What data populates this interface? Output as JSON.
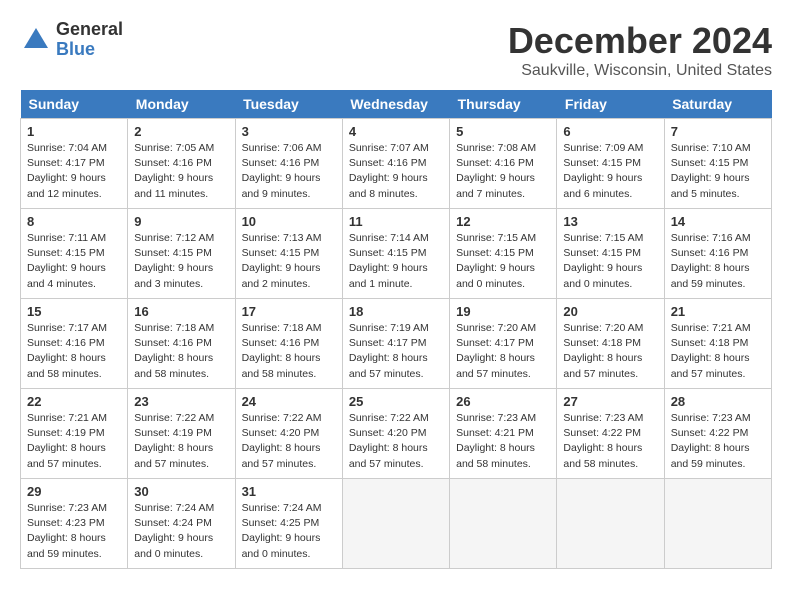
{
  "logo": {
    "general": "General",
    "blue": "Blue"
  },
  "title": "December 2024",
  "subtitle": "Saukville, Wisconsin, United States",
  "days_of_week": [
    "Sunday",
    "Monday",
    "Tuesday",
    "Wednesday",
    "Thursday",
    "Friday",
    "Saturday"
  ],
  "weeks": [
    [
      {
        "day": "1",
        "sunrise": "Sunrise: 7:04 AM",
        "sunset": "Sunset: 4:17 PM",
        "daylight": "Daylight: 9 hours and 12 minutes."
      },
      {
        "day": "2",
        "sunrise": "Sunrise: 7:05 AM",
        "sunset": "Sunset: 4:16 PM",
        "daylight": "Daylight: 9 hours and 11 minutes."
      },
      {
        "day": "3",
        "sunrise": "Sunrise: 7:06 AM",
        "sunset": "Sunset: 4:16 PM",
        "daylight": "Daylight: 9 hours and 9 minutes."
      },
      {
        "day": "4",
        "sunrise": "Sunrise: 7:07 AM",
        "sunset": "Sunset: 4:16 PM",
        "daylight": "Daylight: 9 hours and 8 minutes."
      },
      {
        "day": "5",
        "sunrise": "Sunrise: 7:08 AM",
        "sunset": "Sunset: 4:16 PM",
        "daylight": "Daylight: 9 hours and 7 minutes."
      },
      {
        "day": "6",
        "sunrise": "Sunrise: 7:09 AM",
        "sunset": "Sunset: 4:15 PM",
        "daylight": "Daylight: 9 hours and 6 minutes."
      },
      {
        "day": "7",
        "sunrise": "Sunrise: 7:10 AM",
        "sunset": "Sunset: 4:15 PM",
        "daylight": "Daylight: 9 hours and 5 minutes."
      }
    ],
    [
      {
        "day": "8",
        "sunrise": "Sunrise: 7:11 AM",
        "sunset": "Sunset: 4:15 PM",
        "daylight": "Daylight: 9 hours and 4 minutes."
      },
      {
        "day": "9",
        "sunrise": "Sunrise: 7:12 AM",
        "sunset": "Sunset: 4:15 PM",
        "daylight": "Daylight: 9 hours and 3 minutes."
      },
      {
        "day": "10",
        "sunrise": "Sunrise: 7:13 AM",
        "sunset": "Sunset: 4:15 PM",
        "daylight": "Daylight: 9 hours and 2 minutes."
      },
      {
        "day": "11",
        "sunrise": "Sunrise: 7:14 AM",
        "sunset": "Sunset: 4:15 PM",
        "daylight": "Daylight: 9 hours and 1 minute."
      },
      {
        "day": "12",
        "sunrise": "Sunrise: 7:15 AM",
        "sunset": "Sunset: 4:15 PM",
        "daylight": "Daylight: 9 hours and 0 minutes."
      },
      {
        "day": "13",
        "sunrise": "Sunrise: 7:15 AM",
        "sunset": "Sunset: 4:15 PM",
        "daylight": "Daylight: 9 hours and 0 minutes."
      },
      {
        "day": "14",
        "sunrise": "Sunrise: 7:16 AM",
        "sunset": "Sunset: 4:16 PM",
        "daylight": "Daylight: 8 hours and 59 minutes."
      }
    ],
    [
      {
        "day": "15",
        "sunrise": "Sunrise: 7:17 AM",
        "sunset": "Sunset: 4:16 PM",
        "daylight": "Daylight: 8 hours and 58 minutes."
      },
      {
        "day": "16",
        "sunrise": "Sunrise: 7:18 AM",
        "sunset": "Sunset: 4:16 PM",
        "daylight": "Daylight: 8 hours and 58 minutes."
      },
      {
        "day": "17",
        "sunrise": "Sunrise: 7:18 AM",
        "sunset": "Sunset: 4:16 PM",
        "daylight": "Daylight: 8 hours and 58 minutes."
      },
      {
        "day": "18",
        "sunrise": "Sunrise: 7:19 AM",
        "sunset": "Sunset: 4:17 PM",
        "daylight": "Daylight: 8 hours and 57 minutes."
      },
      {
        "day": "19",
        "sunrise": "Sunrise: 7:20 AM",
        "sunset": "Sunset: 4:17 PM",
        "daylight": "Daylight: 8 hours and 57 minutes."
      },
      {
        "day": "20",
        "sunrise": "Sunrise: 7:20 AM",
        "sunset": "Sunset: 4:18 PM",
        "daylight": "Daylight: 8 hours and 57 minutes."
      },
      {
        "day": "21",
        "sunrise": "Sunrise: 7:21 AM",
        "sunset": "Sunset: 4:18 PM",
        "daylight": "Daylight: 8 hours and 57 minutes."
      }
    ],
    [
      {
        "day": "22",
        "sunrise": "Sunrise: 7:21 AM",
        "sunset": "Sunset: 4:19 PM",
        "daylight": "Daylight: 8 hours and 57 minutes."
      },
      {
        "day": "23",
        "sunrise": "Sunrise: 7:22 AM",
        "sunset": "Sunset: 4:19 PM",
        "daylight": "Daylight: 8 hours and 57 minutes."
      },
      {
        "day": "24",
        "sunrise": "Sunrise: 7:22 AM",
        "sunset": "Sunset: 4:20 PM",
        "daylight": "Daylight: 8 hours and 57 minutes."
      },
      {
        "day": "25",
        "sunrise": "Sunrise: 7:22 AM",
        "sunset": "Sunset: 4:20 PM",
        "daylight": "Daylight: 8 hours and 57 minutes."
      },
      {
        "day": "26",
        "sunrise": "Sunrise: 7:23 AM",
        "sunset": "Sunset: 4:21 PM",
        "daylight": "Daylight: 8 hours and 58 minutes."
      },
      {
        "day": "27",
        "sunrise": "Sunrise: 7:23 AM",
        "sunset": "Sunset: 4:22 PM",
        "daylight": "Daylight: 8 hours and 58 minutes."
      },
      {
        "day": "28",
        "sunrise": "Sunrise: 7:23 AM",
        "sunset": "Sunset: 4:22 PM",
        "daylight": "Daylight: 8 hours and 59 minutes."
      }
    ],
    [
      {
        "day": "29",
        "sunrise": "Sunrise: 7:23 AM",
        "sunset": "Sunset: 4:23 PM",
        "daylight": "Daylight: 8 hours and 59 minutes."
      },
      {
        "day": "30",
        "sunrise": "Sunrise: 7:24 AM",
        "sunset": "Sunset: 4:24 PM",
        "daylight": "Daylight: 9 hours and 0 minutes."
      },
      {
        "day": "31",
        "sunrise": "Sunrise: 7:24 AM",
        "sunset": "Sunset: 4:25 PM",
        "daylight": "Daylight: 9 hours and 0 minutes."
      },
      null,
      null,
      null,
      null
    ]
  ]
}
